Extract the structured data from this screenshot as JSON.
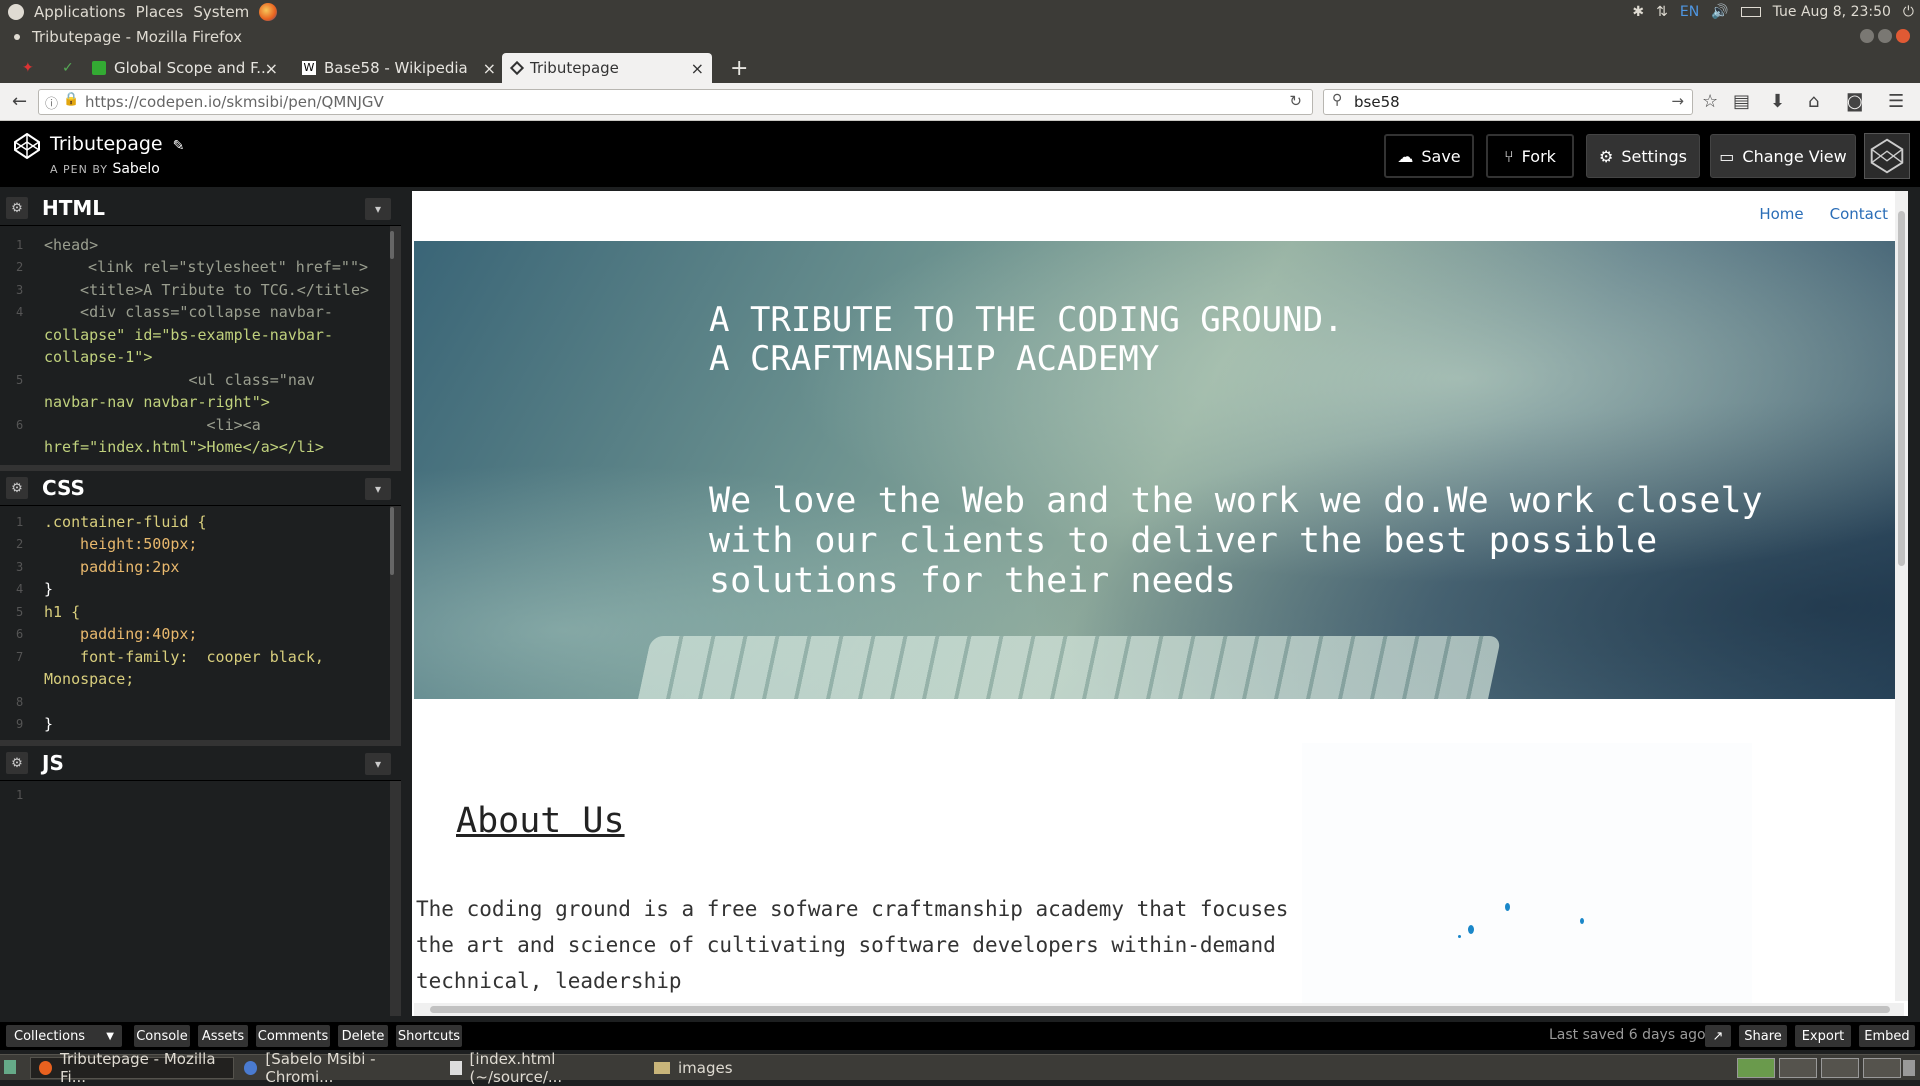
{
  "gnome_panel": {
    "menus": [
      "Applications",
      "Places",
      "System"
    ],
    "lang": "EN",
    "clock": "Tue Aug 8, 23:50"
  },
  "window": {
    "title": "Tributepage - Mozilla Firefox"
  },
  "tabs": [
    {
      "label": "Global Scope and F..."
    },
    {
      "label": "Base58 - Wikipedia"
    },
    {
      "label": "Tributepage",
      "active": true
    }
  ],
  "navbar": {
    "url": "https://codepen.io/skmsibi/pen/QMNJGV",
    "search": "bse58"
  },
  "codepen": {
    "pen_title": "Tributepage",
    "by_prefix": "A PEN BY",
    "author": "Sabelo",
    "buttons": {
      "save": "Save",
      "fork": "Fork",
      "settings": "Settings",
      "change_view": "Change View"
    }
  },
  "editors": {
    "html": {
      "title": "HTML",
      "line_numbers": [
        "1",
        "2",
        "3",
        "4",
        "5",
        "6"
      ],
      "lines": [
        "<head>",
        "  <link rel=\"stylesheet\" href=\"\">",
        "  <title>A Tribute to TCG.</title>",
        "  <div class=\"collapse navbar-",
        "collapse\" id=\"bs-example-navbar-",
        "collapse-1\">",
        "                <ul class=\"nav",
        "navbar-nav navbar-right\">",
        "                  <li><a",
        "href=\"index.html\">Home</a></li>"
      ]
    },
    "css": {
      "title": "CSS",
      "line_numbers": [
        "1",
        "2",
        "3",
        "4",
        "5",
        "6",
        "7",
        "8",
        "9"
      ],
      "lines": [
        ".container-fluid {",
        "  height:500px;",
        "  padding:2px",
        "}",
        "h1 {",
        "  padding:40px;",
        "  font-family:  cooper black,",
        "Monospace;",
        "",
        "}"
      ]
    },
    "js": {
      "title": "JS",
      "line_numbers": [
        "1"
      ]
    }
  },
  "preview": {
    "nav": {
      "home": "Home",
      "contact": "Contact"
    },
    "hero_title": "A TRIBUTE TO THE CODING GROUND.\nA CRAFTMANSHIP ACADEMY",
    "hero_text": "We love the Web and the work we do.We work closely with our clients to deliver the best possible solutions for their needs",
    "about_title": "About Us",
    "about_text": "The coding ground is a free sofware craftmanship academy that focuses on the art and science of cultivating software developers within-demand technical, leadership"
  },
  "footer": {
    "collections": "Collections",
    "console": "Console",
    "assets": "Assets",
    "comments": "Comments",
    "delete": "Delete",
    "shortcuts": "Shortcuts",
    "last_saved": "Last saved 6 days ago",
    "share": "Share",
    "export": "Export",
    "embed": "Embed"
  },
  "taskbar": [
    {
      "label": "Tributepage - Mozilla Fi...",
      "active": true
    },
    {
      "label": "[Sabelo Msibi - Chromi..."
    },
    {
      "label": "[index.html (~/source/..."
    },
    {
      "label": "images"
    }
  ]
}
